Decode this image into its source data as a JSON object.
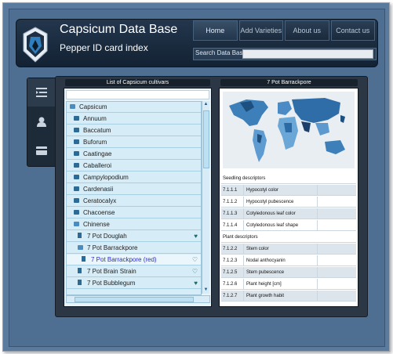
{
  "header": {
    "title": "Capsicum Data Base",
    "subtitle": "Pepper ID card index",
    "nav": [
      "Home",
      "Add Varieties",
      "About us",
      "Contact us"
    ],
    "search_label": "Search Data Base"
  },
  "side_tabs": [
    "list-icon",
    "user-icon",
    "card-icon"
  ],
  "left_panel": {
    "title": "List of Capsicum cultivars",
    "tree": [
      {
        "label": "Capsicum",
        "type": "folder-open",
        "level": 0
      },
      {
        "label": "Annuum",
        "type": "folder",
        "level": 1
      },
      {
        "label": "Baccatum",
        "type": "folder",
        "level": 1
      },
      {
        "label": "Buforum",
        "type": "folder",
        "level": 1
      },
      {
        "label": "Caatingae",
        "type": "folder",
        "level": 1
      },
      {
        "label": "Caballeroi",
        "type": "folder",
        "level": 1
      },
      {
        "label": "Campylopodium",
        "type": "folder",
        "level": 1
      },
      {
        "label": "Cardenasii",
        "type": "folder",
        "level": 1
      },
      {
        "label": "Ceratocalyx",
        "type": "folder",
        "level": 1
      },
      {
        "label": "Chacoense",
        "type": "folder",
        "level": 1
      },
      {
        "label": "Chinense",
        "type": "folder-open",
        "level": 1
      },
      {
        "label": "7 Pot Douglah",
        "type": "file",
        "level": 2,
        "favorite": true
      },
      {
        "label": "7 Pot Barrackpore",
        "type": "folder-open",
        "level": 2
      },
      {
        "label": "7 Pot Barrackpore (red)",
        "type": "file",
        "level": 3,
        "favorite": false,
        "selected": true
      },
      {
        "label": "7 Pot Brain Strain",
        "type": "file",
        "level": 2,
        "favorite": false
      },
      {
        "label": "7 Pot Bubblegum",
        "type": "file",
        "level": 2,
        "favorite": true
      }
    ]
  },
  "right_panel": {
    "title": "7 Pot Barrackpore",
    "sections": [
      {
        "heading": "Seedling descriptors",
        "rows": [
          {
            "code": "7.1.1.1",
            "name": "Hypocotyl color"
          },
          {
            "code": "7.1.1.2",
            "name": "Hypocotyl pubescence"
          },
          {
            "code": "7.1.1.3",
            "name": "Cotyledonous leaf color"
          },
          {
            "code": "7.1.1.4",
            "name": "Cotyledonous leaf shape"
          }
        ]
      },
      {
        "heading": "Plant descriptors",
        "rows": [
          {
            "code": "7.1.2.2",
            "name": "Stem color"
          },
          {
            "code": "7.1.2.3",
            "name": "Nodal anthocyanin"
          },
          {
            "code": "7.1.2.5",
            "name": "Stem pubescence"
          },
          {
            "code": "7.1.2.6",
            "name": "Plant height [cm]"
          },
          {
            "code": "7.1.2.7",
            "name": "Plant growth habit"
          }
        ]
      }
    ]
  },
  "colors": {
    "accent": "#2d6b97",
    "header_bg": "#1a2a3c",
    "panel_bg": "#2b3744",
    "page_bg": "#5a7a9e"
  }
}
